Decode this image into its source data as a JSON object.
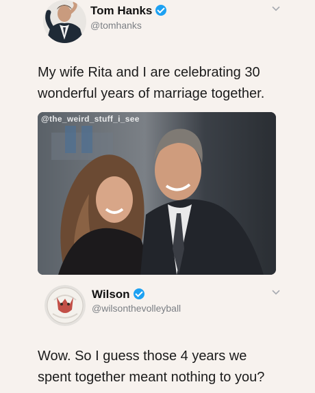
{
  "tweet": {
    "author_name": "Tom Hanks",
    "author_handle": "@tomhanks",
    "text_line1": "My wife Rita and I are celebrating 30",
    "text_line2": "wonderful years of marriage together.",
    "photo_watermark": "@the_weird_stuff_i_see",
    "verified_icon": "verified-badge-icon",
    "menu_icon": "chevron-down-icon"
  },
  "reply": {
    "author_name": "Wilson",
    "author_handle": "@wilsonthevolleyball",
    "text_line1": "Wow. So I guess those 4 years we",
    "text_line2": "spent together meant nothing to you?",
    "verified_icon": "verified-badge-icon",
    "menu_icon": "chevron-down-icon"
  },
  "colors": {
    "background": "#f7f2ee",
    "verified_blue": "#1da1f2",
    "handle_gray": "#7b7f84"
  }
}
